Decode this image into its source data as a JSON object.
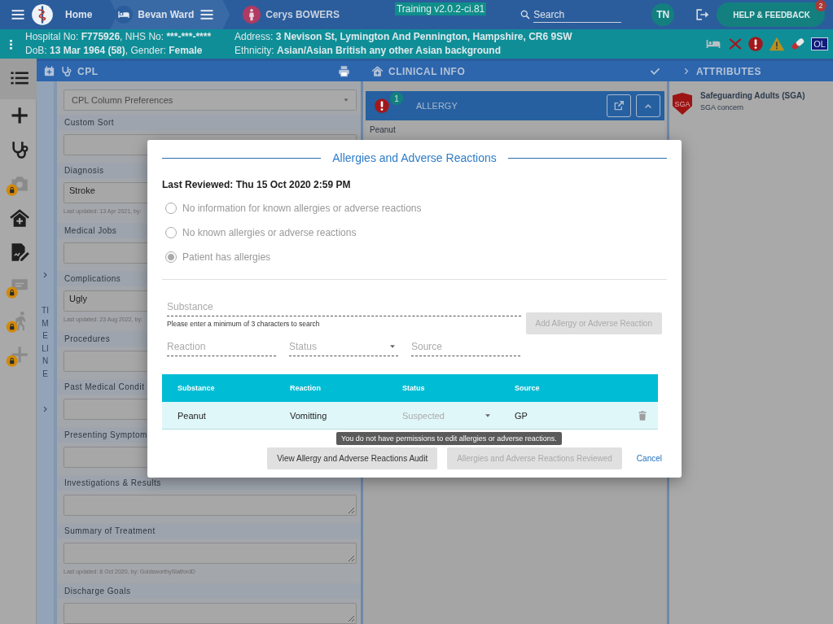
{
  "topbar": {
    "home": "Home",
    "ward": "Bevan Ward",
    "patient": "Cerys BOWERS",
    "environment": "Training v2.0.2-ci.81",
    "search": {
      "placeholder": "Search"
    },
    "user_initials": "TN",
    "help": {
      "label": "HELP & FEEDBACK",
      "badge": "2"
    }
  },
  "banner": {
    "columns": [
      [
        [
          {
            "label": "Hospital No: ",
            "value": "F775926"
          },
          {
            "label": ", NHS No: ",
            "value": "***-***-****"
          }
        ],
        [
          {
            "label": "DoB: ",
            "value": "13 Mar 1964 (58)"
          },
          {
            "label": ", Gender: ",
            "value": "Female"
          }
        ]
      ],
      [
        [
          {
            "label": "Address: ",
            "value": "3 Nevison St, Lymington And Pennington, Hampshire, CR6 9SW"
          }
        ],
        [
          {
            "label": "Ethnicity: ",
            "value": "Asian/Asian British any other Asian background"
          }
        ]
      ]
    ],
    "alerts": [
      {
        "kind": "bed"
      },
      {
        "kind": "cross"
      },
      {
        "kind": "exclamation"
      },
      {
        "kind": "warning"
      },
      {
        "kind": "pill"
      },
      {
        "kind": "flag",
        "label": "OL"
      }
    ]
  },
  "sidebar": {
    "items": [
      {
        "kind": "list",
        "locked": false
      },
      {
        "kind": "add",
        "locked": false
      },
      {
        "kind": "stethoscope",
        "locked": false
      },
      {
        "kind": "camera",
        "locked": true
      },
      {
        "kind": "house",
        "locked": false
      },
      {
        "kind": "edit",
        "locked": false
      },
      {
        "kind": "chat",
        "locked": true
      },
      {
        "kind": "walker",
        "locked": true
      },
      {
        "kind": "add",
        "locked": true
      }
    ]
  },
  "timeline": {
    "label": "TIMELINE"
  },
  "cpl": {
    "title": "CPL",
    "column_preferences": "CPL Column Preferences",
    "sections": [
      {
        "label": "Custom Sort",
        "kind": "input"
      },
      {
        "label": "Diagnosis",
        "kind": "input",
        "value": "Stroke",
        "last_updated": "Last updated: 13 Apr 2021, by:"
      },
      {
        "label": "Medical Jobs",
        "kind": "input"
      },
      {
        "label": "Complications",
        "kind": "input",
        "value": "Ugly",
        "last_updated": "Last updated: 23 Aug 2022, by:"
      },
      {
        "label": "Procedures",
        "kind": "input"
      },
      {
        "label": "Past Medical Condit",
        "kind": "input"
      },
      {
        "label": "Presenting Symptom",
        "kind": "input"
      },
      {
        "label": "Investigations & Results",
        "kind": "textarea"
      },
      {
        "label": "Summary of Treatment",
        "kind": "textarea",
        "last_updated": "Last updated: 8 Oct 2020, by: GoldsworthySlatfordD"
      },
      {
        "label": "Discharge Goals",
        "kind": "textarea"
      }
    ]
  },
  "clinical_info": {
    "title": "CLINICAL INFO",
    "allergy_card": {
      "title": "ALLERGY",
      "count": "1",
      "items": [
        "Peanut"
      ]
    }
  },
  "attributes": {
    "title": "ATTRIBUTES",
    "items": [
      {
        "badge": "SGA",
        "title": "Safeguarding Adults (SGA)",
        "detail": "SGA concern"
      }
    ]
  },
  "modal": {
    "title": "Allergies and Adverse Reactions",
    "last_reviewed": "Last Reviewed: Thu 15 Oct 2020 2:59 PM",
    "options": [
      {
        "label": "No information for known allergies or adverse reactions",
        "selected": false,
        "disabled": true
      },
      {
        "label": "No known allergies or adverse reactions",
        "selected": false,
        "disabled": true
      },
      {
        "label": "Patient has allergies",
        "selected": true,
        "disabled": true
      }
    ],
    "substance": {
      "placeholder": "Substance",
      "hint": "Please enter a minimum of 3 characters to search"
    },
    "add_button": {
      "label": "Add Allergy or Adverse Reaction",
      "disabled": true
    },
    "reaction": {
      "placeholder": "Reaction"
    },
    "status": {
      "placeholder": "Status"
    },
    "source": {
      "placeholder": "Source"
    },
    "table": {
      "columns": [
        "Substance",
        "Reaction",
        "Status",
        "Source"
      ],
      "rows": [
        {
          "substance": "Peanut",
          "reaction": "Vomitting",
          "status": "Suspected",
          "status_disabled": true,
          "source": "GP"
        }
      ]
    },
    "buttons": [
      {
        "label": "View Allergy and Adverse Reactions Audit",
        "kind": "secondary",
        "disabled": false
      },
      {
        "label": "Allergies and Adverse Reactions Reviewed",
        "kind": "secondary",
        "disabled": true
      },
      {
        "label": "Cancel",
        "kind": "link",
        "disabled": false
      }
    ],
    "tooltip": "You do not have permissions to edit allergies or adverse reactions."
  }
}
